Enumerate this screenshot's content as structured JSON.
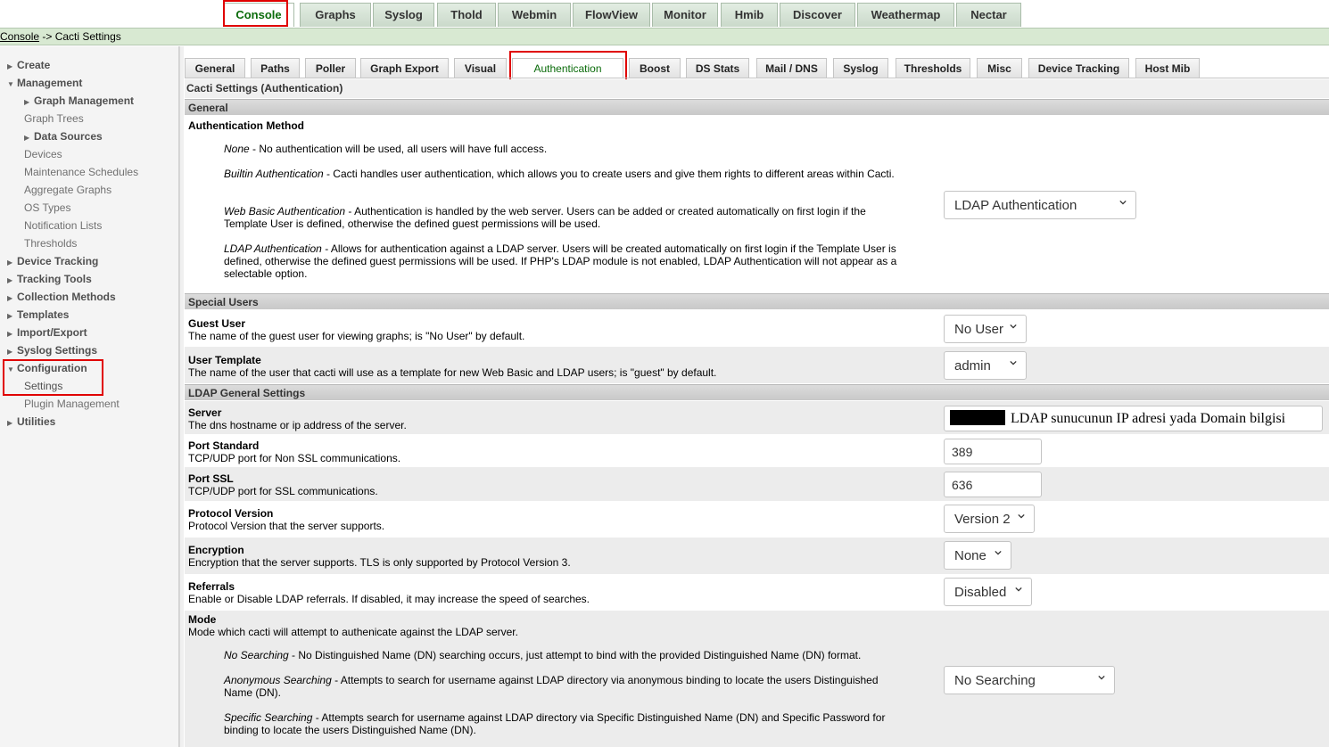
{
  "top_tabs": [
    "Console",
    "Graphs",
    "Syslog",
    "Thold",
    "Webmin",
    "FlowView",
    "Monitor",
    "Hmib",
    "Discover",
    "Weathermap",
    "Nectar"
  ],
  "breadcrumb": {
    "link": "Console",
    "separator": " -> ",
    "current": "Cacti Settings"
  },
  "sidebar": {
    "create": "Create",
    "management": "Management",
    "management_items": [
      "Graph Management",
      "Graph Trees",
      "Data Sources",
      "Devices",
      "Maintenance Schedules",
      "Aggregate Graphs",
      "OS Types",
      "Notification Lists",
      "Thresholds"
    ],
    "device_tracking": "Device Tracking",
    "tracking_tools": "Tracking Tools",
    "collection_methods": "Collection Methods",
    "templates": "Templates",
    "import_export": "Import/Export",
    "syslog_settings": "Syslog Settings",
    "configuration": "Configuration",
    "configuration_items": [
      "Settings",
      "Plugin Management"
    ],
    "utilities": "Utilities"
  },
  "settings_tabs": [
    "General",
    "Paths",
    "Poller",
    "Graph Export",
    "Visual",
    "Authentication",
    "Boost",
    "DS Stats",
    "Mail / DNS",
    "Syslog",
    "Thresholds",
    "Misc",
    "Device Tracking",
    "Host Mib"
  ],
  "page_title": "Cacti Settings (Authentication)",
  "general": {
    "header": "General",
    "auth_method": {
      "label": "Authentication Method",
      "none_title": "None",
      "none_text": " - No authentication will be used, all users will have full access.",
      "builtin_title": "Builtin Authentication",
      "builtin_text": " - Cacti handles user authentication, which allows you to create users and give them rights to different areas within Cacti.",
      "webbasic_title": "Web Basic Authentication",
      "webbasic_text": " - Authentication is handled by the web server. Users can be added or created automatically on first login if the Template User is defined, otherwise the defined guest permissions will be used.",
      "ldap_title": "LDAP Authentication",
      "ldap_text": " - Allows for authentication against a LDAP server. Users will be created automatically on first login if the Template User is defined, otherwise the defined guest permissions will be used. If PHP's LDAP module is not enabled, LDAP Authentication will not appear as a selectable option.",
      "value": "LDAP Authentication"
    }
  },
  "special_users": {
    "header": "Special Users",
    "guest_user": {
      "label": "Guest User",
      "desc": "The name of the guest user for viewing graphs; is \"No User\" by default.",
      "value": "No User"
    },
    "user_template": {
      "label": "User Template",
      "desc": "The name of the user that cacti will use as a template for new Web Basic and LDAP users; is \"guest\" by default.",
      "value": "admin"
    }
  },
  "ldap_general": {
    "header": "LDAP General Settings",
    "server": {
      "label": "Server",
      "desc": "The dns hostname or ip address of the server.",
      "value": "LDAP sunucunun IP adresi yada Domain bilgisi"
    },
    "port_standard": {
      "label": "Port Standard",
      "desc": "TCP/UDP port for Non SSL communications.",
      "value": "389"
    },
    "port_ssl": {
      "label": "Port SSL",
      "desc": "TCP/UDP port for SSL communications.",
      "value": "636"
    },
    "protocol_version": {
      "label": "Protocol Version",
      "desc": "Protocol Version that the server supports.",
      "value": "Version 2"
    },
    "encryption": {
      "label": "Encryption",
      "desc": "Encryption that the server supports. TLS is only supported by Protocol Version 3.",
      "value": "None"
    },
    "referrals": {
      "label": "Referrals",
      "desc": "Enable or Disable LDAP referrals. If disabled, it may increase the speed of searches.",
      "value": "Disabled"
    },
    "mode": {
      "label": "Mode",
      "desc": "Mode which cacti will attempt to authenicate against the LDAP server.",
      "nosearch_title": "No Searching",
      "nosearch_text": " - No Distinguished Name (DN) searching occurs, just attempt to bind with the provided Distinguished Name (DN) format.",
      "anon_title": "Anonymous Searching",
      "anon_text": " - Attempts to search for username against LDAP directory via anonymous binding to locate the users Distinguished Name (DN).",
      "specific_title": "Specific Searching",
      "specific_text": " - Attempts search for username against LDAP directory via Specific Distinguished Name (DN) and Specific Password for binding to locate the users Distinguished Name (DN).",
      "value": "No Searching"
    }
  },
  "colors": {
    "highlight_red": "#e00000",
    "active_green": "#0a6b0a",
    "breadcrumb_bg": "#d8e9d2"
  }
}
